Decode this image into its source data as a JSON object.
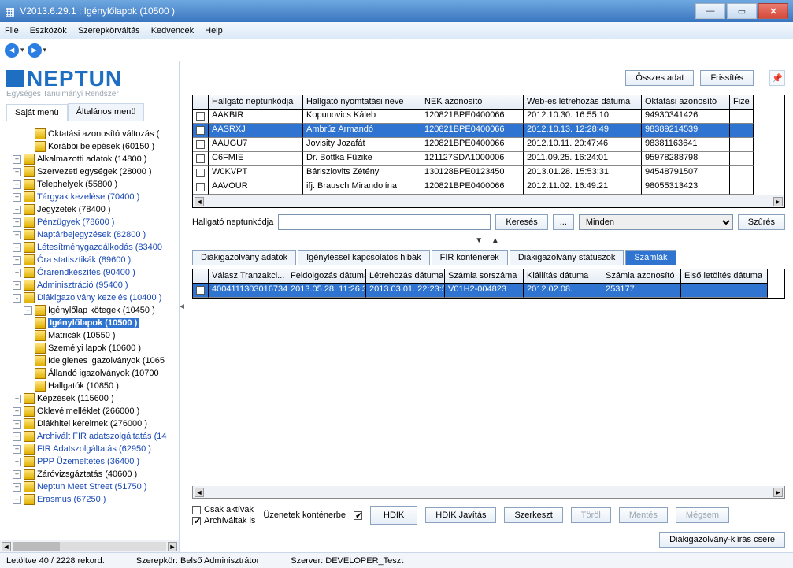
{
  "window": {
    "title": "V2013.6.29.1 : Igénylőlapok (10500  )"
  },
  "menu": {
    "file": "File",
    "tools": "Eszközök",
    "roleswap": "Szerepkörváltás",
    "fav": "Kedvencek",
    "help": "Help"
  },
  "logo": {
    "main": "NEPTUN",
    "sub": "Egységes Tanulmányi Rendszer"
  },
  "left_tabs": {
    "saj": "Saját menü",
    "alt": "Általános menü"
  },
  "tree": [
    {
      "ind": 2,
      "exp": "",
      "lbl": "Oktatási azonosító változás ( ",
      "blue": false
    },
    {
      "ind": 2,
      "exp": "",
      "lbl": "Korábbi belépések (60150  )",
      "blue": false
    },
    {
      "ind": 1,
      "exp": "+",
      "lbl": "Alkalmazotti adatok (14800  )",
      "blue": false
    },
    {
      "ind": 1,
      "exp": "+",
      "lbl": "Szervezeti egységek (28000  )",
      "blue": false
    },
    {
      "ind": 1,
      "exp": "+",
      "lbl": "Telephelyek (55800 )",
      "blue": false
    },
    {
      "ind": 1,
      "exp": "+",
      "lbl": "Tárgyak kezelése (70400  )",
      "blue": true
    },
    {
      "ind": 1,
      "exp": "+",
      "lbl": "Jegyzetek (78400  )",
      "blue": false
    },
    {
      "ind": 1,
      "exp": "+",
      "lbl": "Pénzügyek (78600  )",
      "blue": true
    },
    {
      "ind": 1,
      "exp": "+",
      "lbl": "Naptárbejegyzések (82800  )",
      "blue": true
    },
    {
      "ind": 1,
      "exp": "+",
      "lbl": "Létesítménygazdálkodás (83400",
      "blue": true
    },
    {
      "ind": 1,
      "exp": "+",
      "lbl": "Óra statisztikák (89600  )",
      "blue": true
    },
    {
      "ind": 1,
      "exp": "+",
      "lbl": "Órarendkészítés (90400  )",
      "blue": true
    },
    {
      "ind": 1,
      "exp": "+",
      "lbl": "Adminisztráció (95400  )",
      "blue": true
    },
    {
      "ind": 1,
      "exp": "-",
      "lbl": "Diákigazolvány kezelés (10400  )",
      "blue": true
    },
    {
      "ind": 2,
      "exp": "+",
      "lbl": "Igénylőlap kötegek (10450  )",
      "blue": false
    },
    {
      "ind": 2,
      "exp": "",
      "lbl": "Igénylőlapok (10500  )",
      "blue": false,
      "sel": true
    },
    {
      "ind": 2,
      "exp": "",
      "lbl": "Matricák (10550  )",
      "blue": false
    },
    {
      "ind": 2,
      "exp": "",
      "lbl": "Személyi lapok (10600  )",
      "blue": false
    },
    {
      "ind": 2,
      "exp": "",
      "lbl": "Ideiglenes igazolványok (1065",
      "blue": false
    },
    {
      "ind": 2,
      "exp": "",
      "lbl": "Állandó igazolványok (10700",
      "blue": false
    },
    {
      "ind": 2,
      "exp": "",
      "lbl": "Hallgatók (10850  )",
      "blue": false
    },
    {
      "ind": 1,
      "exp": "+",
      "lbl": "Képzések (115600  )",
      "blue": false
    },
    {
      "ind": 1,
      "exp": "+",
      "lbl": "Oklevélmelléklet (266000  )",
      "blue": false
    },
    {
      "ind": 1,
      "exp": "+",
      "lbl": "Diákhitel kérelmek (276000  )",
      "blue": false
    },
    {
      "ind": 1,
      "exp": "+",
      "lbl": "Archivált FIR adatszolgáltatás (14",
      "blue": true
    },
    {
      "ind": 1,
      "exp": "+",
      "lbl": "FIR Adatszolgáltatás (62950  )",
      "blue": true
    },
    {
      "ind": 1,
      "exp": "+",
      "lbl": "PPP Üzemeltetés (36400  )",
      "blue": true
    },
    {
      "ind": 1,
      "exp": "+",
      "lbl": "Záróvizsgáztatás (40600  )",
      "blue": false
    },
    {
      "ind": 1,
      "exp": "+",
      "lbl": "Neptun Meet Street (51750  )",
      "blue": true
    },
    {
      "ind": 1,
      "exp": "+",
      "lbl": "Erasmus (67250  )",
      "blue": true
    }
  ],
  "top_buttons": {
    "all": "Összes adat",
    "refresh": "Frissítés"
  },
  "grid": {
    "headers": [
      "",
      "Hallgató neptunkódja",
      "Hallgató nyomtatási neve",
      "NEK azonosító",
      "Web-es létrehozás dátuma",
      "Oktatási azonosító",
      "Fize"
    ],
    "widths": [
      20,
      120,
      150,
      130,
      150,
      112,
      30
    ],
    "rows": [
      {
        "cells": [
          "",
          "AAKBIR",
          "Kopunovics Káleb",
          "120821BPE0400066",
          "2012.10.30. 16:55:10",
          "94930341426",
          ""
        ]
      },
      {
        "cells": [
          "",
          "AASRXJ",
          "Ambrúz Armandó",
          "120821BPE0400066",
          "2012.10.13. 12:28:49",
          "98389214539",
          ""
        ],
        "sel": true
      },
      {
        "cells": [
          "",
          "AAUGU7",
          "Jovisity Jozafát",
          "120821BPE0400066",
          "2012.10.11. 20:47:46",
          "98381163641",
          ""
        ]
      },
      {
        "cells": [
          "",
          "C6FMIE",
          "Dr. Bottka Füzike",
          "121127SDA1000006",
          "2011.09.25. 16:24:01",
          "95978288798",
          ""
        ]
      },
      {
        "cells": [
          "",
          "W0KVPT",
          "Báriszlovits Zétény",
          "130128BPE0123450",
          "2013.01.28. 15:53:31",
          "94548791507",
          ""
        ]
      },
      {
        "cells": [
          "",
          "AAVOUR",
          "ifj. Brausch Mirandolína",
          "120821BPE0400066",
          "2012.11.02. 16:49:21",
          "98055313423",
          ""
        ]
      }
    ]
  },
  "search": {
    "label": "Hallgató neptunkódja",
    "btn": "Keresés",
    "filter_sel": "Minden",
    "filter_btn": "Szűrés"
  },
  "detail_tabs": [
    "Diákigazolvány adatok",
    "Igényléssel kapcsolatos hibák",
    "FIR konténerek",
    "Diákigazolvány státuszok",
    "Számlák"
  ],
  "detail_active": 4,
  "detail_grid": {
    "headers": [
      "",
      "Válasz Tranzakci...",
      "Feldolgozás dátuma",
      "Létrehozás dátuma",
      "Számla sorszáma",
      "Kiállítás dátuma",
      "Számla azonosító",
      "Első letöltés dátuma"
    ],
    "widths": [
      20,
      100,
      100,
      100,
      100,
      100,
      100,
      110
    ],
    "rows": [
      {
        "cells": [
          "",
          "4004111303016734",
          "2013.05.28. 11:26:3",
          "2013.03.01. 22:23:5",
          "V01H2-004823",
          "2012.02.08.",
          "253177",
          ""
        ],
        "sel": true
      }
    ]
  },
  "bottom": {
    "csak": "Csak aktívak",
    "arch": "Archíváltak is",
    "uzk": "Üzenetek konténerbe",
    "hdik": "HDIK",
    "hdikj": "HDIK Javítás",
    "szerk": "Szerkeszt",
    "torol": "Töröl",
    "mentes": "Mentés",
    "megsem": "Mégsem",
    "csere": "Diákigazolvány-kiírás csere"
  },
  "status": {
    "rec": "Letöltve 40 / 2228 rekord.",
    "role": "Szerepkör: Belső Adminisztrátor",
    "srv": "Szerver: DEVELOPER_Teszt"
  }
}
